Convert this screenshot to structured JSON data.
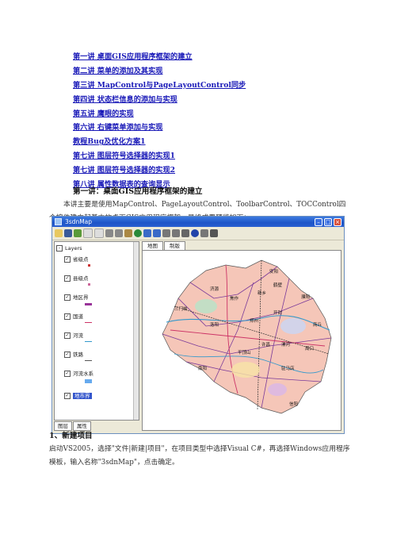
{
  "toc": [
    "第一讲  桌面GIS应用程序框架的建立",
    "第二讲  菜单的添加及其实现",
    "第三讲  MapControl与PageLayoutControl同步",
    "第四讲  状态栏信息的添加与实现",
    "第五讲  鹰眼的实现",
    "第六讲  右键菜单添加与实现",
    "教程Bug及优化方案1",
    "第七讲  图层符号选择器的实现1",
    "第七讲  图层符号选择器的实现2",
    "第八讲  属性数据表的查询显示"
  ],
  "lecture1": {
    "heading": "第一讲：桌面GIS应用程序框架的建立",
    "intro": "本讲主要是使用MapControl、PageLayoutControl、ToolbarControl、TOCControl四个控件建立起基本的桌面GIS应用程序框架。最终成果预览如下："
  },
  "screenshot": {
    "window_title": "3sdnMap",
    "layers_root": "Layers",
    "layers": [
      "省级点",
      "县级点",
      "地区界",
      "国道",
      "河流",
      "铁路",
      "河流水系",
      "地市界"
    ],
    "layer_colors": [
      "#cc3333",
      "#cc6699",
      "#993399",
      "#cc3366",
      "#3399cc",
      "#555555",
      "#66aaee",
      "#3355cc"
    ],
    "left_tabs": [
      "图层",
      "属性"
    ],
    "map_tabs": [
      "地图",
      "制版"
    ],
    "map_labels": [
      "信阳",
      "开封",
      "郑州",
      "许昌",
      "洛阳",
      "平顶山",
      "南阳",
      "三门峡",
      "焦作",
      "新乡",
      "安阳",
      "驻马店",
      "周口",
      "商丘",
      "漯河",
      "濮阳",
      "鹤壁",
      "济源"
    ]
  },
  "section1": {
    "heading": "1、新建项目",
    "text": "启动VS2005，选择\"文件|新建|项目\"，在项目类型中选择Visual C#，再选择Windows应用程序模板，输入名称\"3sdnMap\"，点击确定。"
  }
}
